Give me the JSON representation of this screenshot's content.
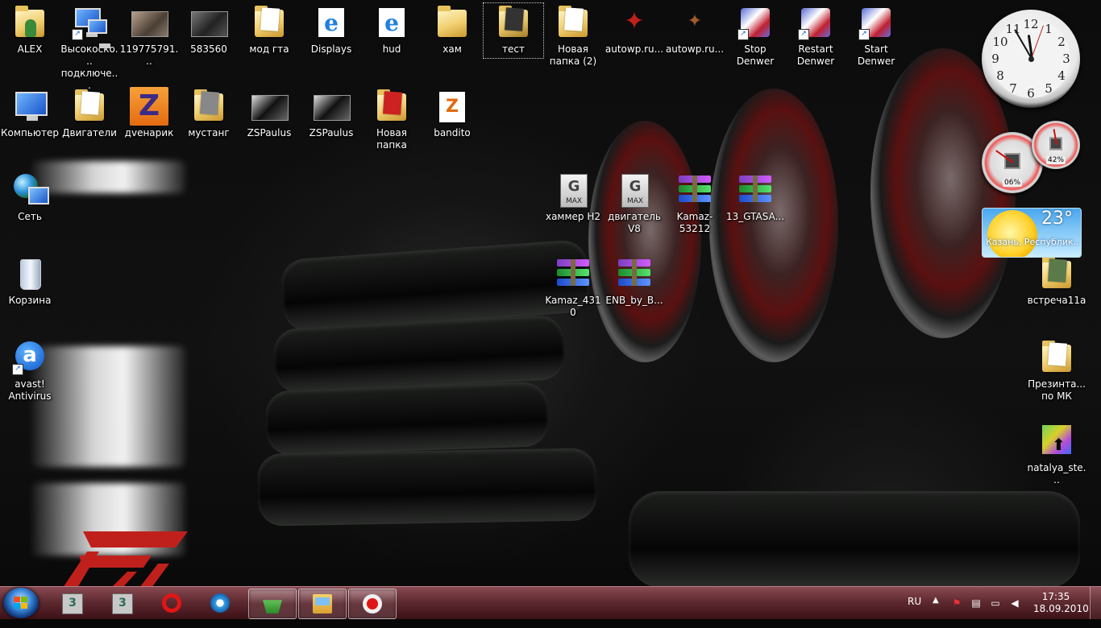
{
  "desktop": {
    "icons": [
      {
        "label": "ALEX"
      },
      {
        "label": "Высокоско... подключе..."
      },
      {
        "label": "119775791..."
      },
      {
        "label": "583560"
      },
      {
        "label": "мод гта"
      },
      {
        "label": "Displays"
      },
      {
        "label": "hud"
      },
      {
        "label": "хам"
      },
      {
        "label": "тест"
      },
      {
        "label": "Новая папка (2)"
      },
      {
        "label": "autowp.ru..."
      },
      {
        "label": "autowp.ru..."
      },
      {
        "label": "Stop Denwer"
      },
      {
        "label": "Restart Denwer"
      },
      {
        "label": "Start Denwer"
      },
      {
        "label": "Компьютер"
      },
      {
        "label": "Двигатели"
      },
      {
        "label": "дvенарик"
      },
      {
        "label": "мустанг"
      },
      {
        "label": "ZSPaulus"
      },
      {
        "label": "ZSPaulus"
      },
      {
        "label": "Новая папка"
      },
      {
        "label": "bandito"
      },
      {
        "label": "Сеть"
      },
      {
        "label": "хаммер H2"
      },
      {
        "label": "двигатель V8"
      },
      {
        "label": "Kamaz-53212"
      },
      {
        "label": "13_GTASA..."
      },
      {
        "label": "Корзина"
      },
      {
        "label": "Kamaz_4310"
      },
      {
        "label": "ENB_by_B..."
      },
      {
        "label": "avast! Antivirus"
      },
      {
        "label": "встреча11а"
      },
      {
        "label": "Презинта... по МК"
      },
      {
        "label": "natalya_ste..."
      }
    ]
  },
  "gadgets": {
    "clock": {
      "numbers": [
        "12",
        "1",
        "2",
        "3",
        "4",
        "5",
        "6",
        "7",
        "8",
        "9",
        "10",
        "11"
      ]
    },
    "cpu_meter": {
      "cpu": "06%",
      "memory": "42%"
    },
    "weather": {
      "temperature": "23°",
      "location": "Казань, Республик..."
    }
  },
  "taskbar": {
    "language": "RU",
    "time": "17:35",
    "date": "18.09.2010",
    "max_label": "3",
    "opera_label": "O"
  }
}
